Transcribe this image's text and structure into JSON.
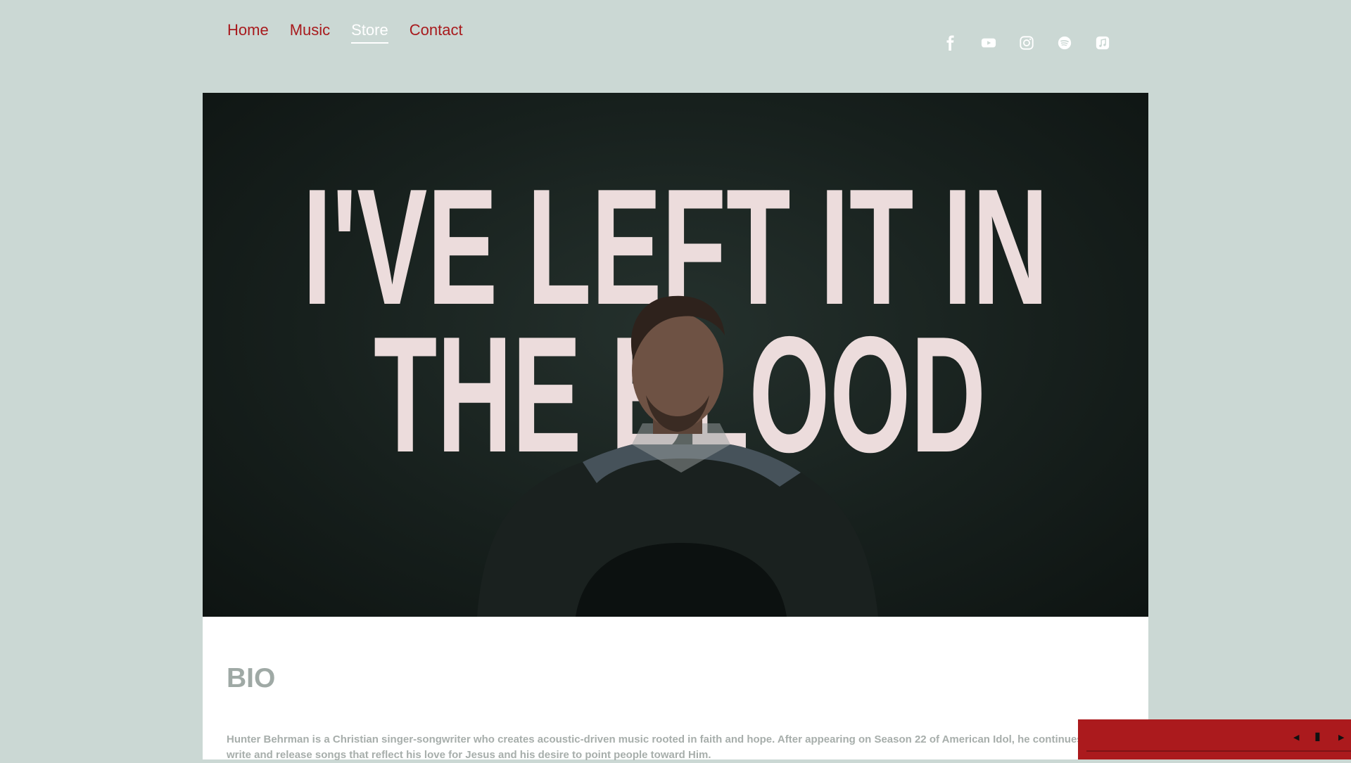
{
  "nav": {
    "items": [
      {
        "label": "Home",
        "active": false
      },
      {
        "label": "Music",
        "active": false
      },
      {
        "label": "Store",
        "active": true
      },
      {
        "label": "Contact",
        "active": false
      }
    ]
  },
  "social": [
    "facebook-icon",
    "youtube-icon",
    "instagram-icon",
    "spotify-icon",
    "apple-music-icon"
  ],
  "hero": {
    "line1": "I'VE LEFT IT IN",
    "line2": "THE BLOOD"
  },
  "bio": {
    "title": "BIO",
    "text": "Hunter Behrman is a Christian singer-songwriter who creates acoustic-driven music rooted in faith and hope. After appearing on Season 22 of American Idol, he continues to write and release songs that reflect his love for Jesus and his desire to point people toward Him."
  },
  "colors": {
    "background": "#cbd8d4",
    "accent": "#a81a1d",
    "player": "#ab1a1d"
  }
}
